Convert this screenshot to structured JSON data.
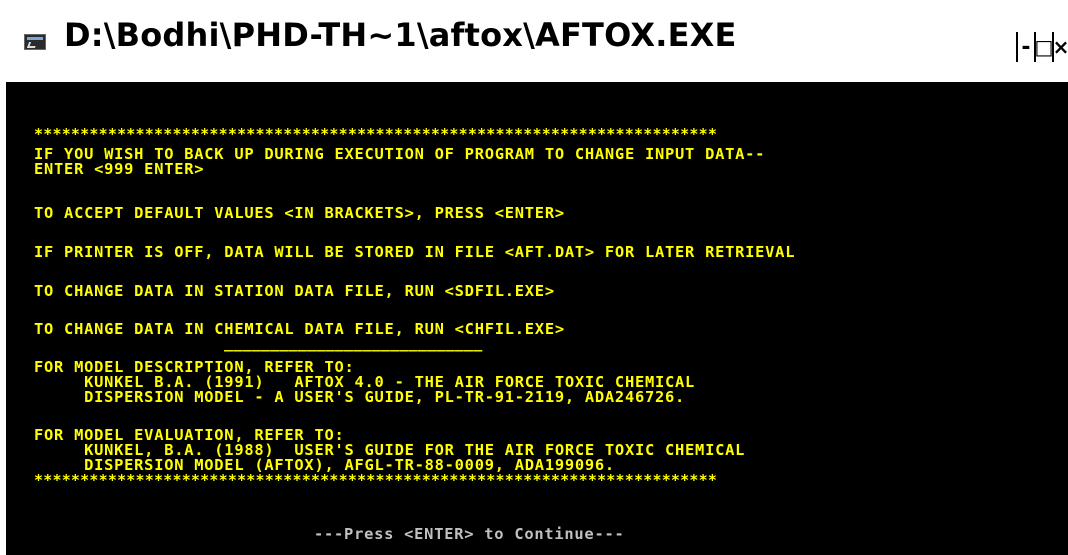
{
  "window": {
    "title": "D:\\Bodhi\\PHD-TH~1\\aftox\\AFTOX.EXE",
    "controls": {
      "minimize": "-",
      "maximize": "□",
      "close": "×"
    }
  },
  "console": {
    "text_color": "#ffff00",
    "background_color": "#000000",
    "stars_top": "**************************************************************************",
    "lines": [
      "IF YOU WISH TO BACK UP DURING EXECUTION OF PROGRAM TO CHANGE INPUT DATA--",
      "ENTER <999 ENTER>",
      "TO ACCEPT DEFAULT VALUES <IN BRACKETS>, PRESS <ENTER>",
      "IF PRINTER IS OFF, DATA WILL BE STORED IN FILE <AFT.DAT> FOR LATER RETRIEVAL",
      "TO CHANGE DATA IN STATION DATA FILE, RUN <SDFIL.EXE>",
      "TO CHANGE DATA IN CHEMICAL DATA FILE, RUN <CHFIL.EXE>",
      "FOR MODEL DESCRIPTION, REFER TO:",
      "     KUNKEL B.A. (1991)   AFTOX 4.0 - THE AIR FORCE TOXIC CHEMICAL",
      "     DISPERSION MODEL - A USER'S GUIDE, PL-TR-91-2119, ADA246726.",
      "FOR MODEL EVALUATION, REFER TO:",
      "     KUNKEL, B.A. (1988)  USER'S GUIDE FOR THE AIR FORCE TOXIC CHEMICAL",
      "     DISPERSION MODEL (AFTOX), AFGL-TR-88-0009, ADA199096."
    ],
    "underline": "____________________________",
    "stars_bottom": "**************************************************************************",
    "prompt": "---Press <ENTER> to Continue---"
  }
}
